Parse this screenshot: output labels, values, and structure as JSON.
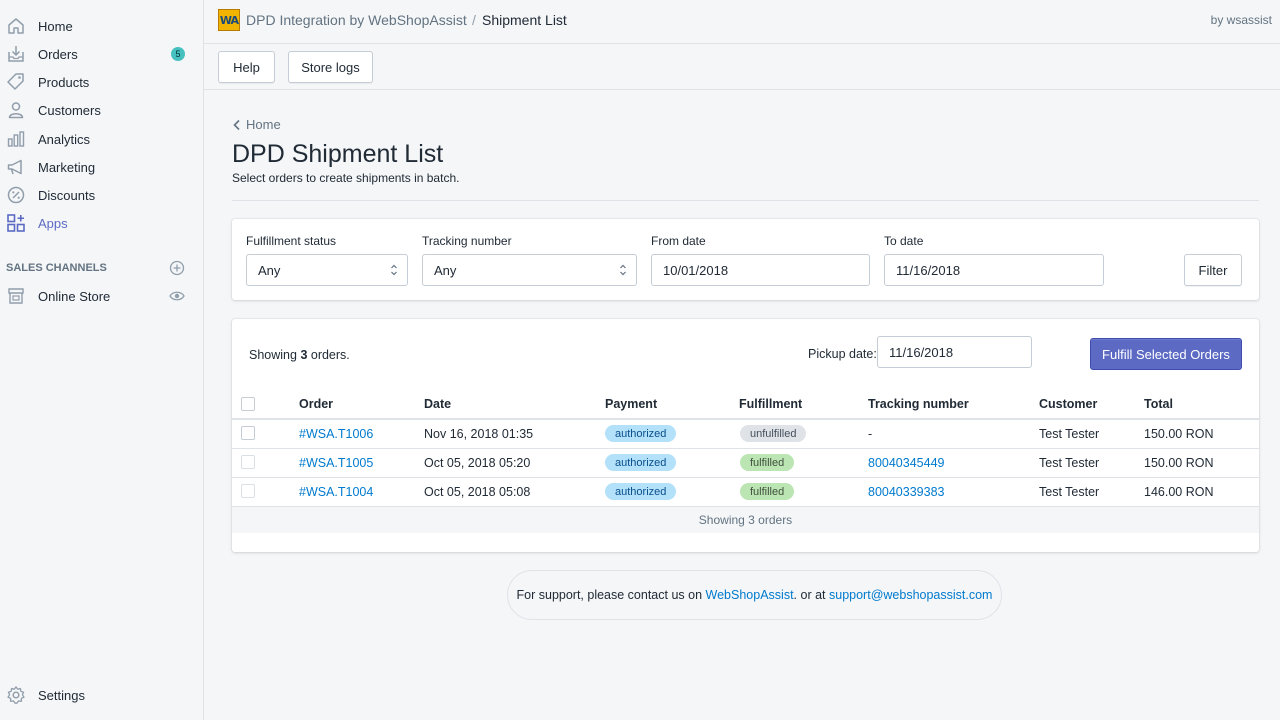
{
  "sidebar": {
    "items": [
      {
        "label": "Home",
        "icon": "home-icon"
      },
      {
        "label": "Orders",
        "icon": "orders-icon",
        "badge": "5"
      },
      {
        "label": "Products",
        "icon": "tag-icon"
      },
      {
        "label": "Customers",
        "icon": "person-icon"
      },
      {
        "label": "Analytics",
        "icon": "bar-chart-icon"
      },
      {
        "label": "Marketing",
        "icon": "megaphone-icon"
      },
      {
        "label": "Discounts",
        "icon": "discount-icon"
      },
      {
        "label": "Apps",
        "icon": "apps-icon"
      }
    ],
    "sales_channels_header": "SALES CHANNELS",
    "online_store": "Online Store",
    "settings": "Settings"
  },
  "topbar": {
    "logo_text": "WA",
    "app_title": "DPD Integration by WebShopAssist",
    "separator": "/",
    "current": "Shipment List",
    "by_author": "by wsassist"
  },
  "actions": {
    "help": "Help",
    "store_logs": "Store logs"
  },
  "page": {
    "back_label": "Home",
    "title": "DPD Shipment List",
    "subtitle": "Select orders to create shipments in batch."
  },
  "filters": {
    "fulfillment_label": "Fulfillment status",
    "fulfillment_value": "Any",
    "tracking_label": "Tracking number",
    "tracking_value": "Any",
    "from_label": "From date",
    "from_value": "10/01/2018",
    "to_label": "To date",
    "to_value": "11/16/2018",
    "filter_button": "Filter"
  },
  "orders_card": {
    "showing_prefix": "Showing ",
    "showing_count": "3",
    "showing_suffix": " orders.",
    "pickup_label": "Pickup date:",
    "pickup_value": "11/16/2018",
    "fulfill_button": "Fulfill Selected Orders",
    "footer": "Showing 3 orders"
  },
  "table": {
    "headers": [
      "Order",
      "Date",
      "Payment",
      "Fulfillment",
      "Tracking number",
      "Customer",
      "Total"
    ],
    "rows": [
      {
        "order": "#WSA.T1006",
        "date": "Nov 16, 2018 01:35",
        "payment": "authorized",
        "fulfillment": "unfulfilled",
        "tracking": "-",
        "customer": "Test Tester",
        "total": "150.00 RON"
      },
      {
        "order": "#WSA.T1005",
        "date": "Oct 05, 2018 05:20",
        "payment": "authorized",
        "fulfillment": "fulfilled",
        "tracking": "80040345449",
        "customer": "Test Tester",
        "total": "150.00 RON"
      },
      {
        "order": "#WSA.T1004",
        "date": "Oct 05, 2018 05:08",
        "payment": "authorized",
        "fulfillment": "fulfilled",
        "tracking": "80040339383",
        "customer": "Test Tester",
        "total": "146.00 RON"
      }
    ]
  },
  "support": {
    "prefix": "For support, please contact us on ",
    "link1": "WebShopAssist",
    "middle": ". or at ",
    "link2": "support@webshopassist.com"
  },
  "colors": {
    "accent": "#5c6ac4",
    "link": "#007ace",
    "badge": "#47c1bf"
  }
}
